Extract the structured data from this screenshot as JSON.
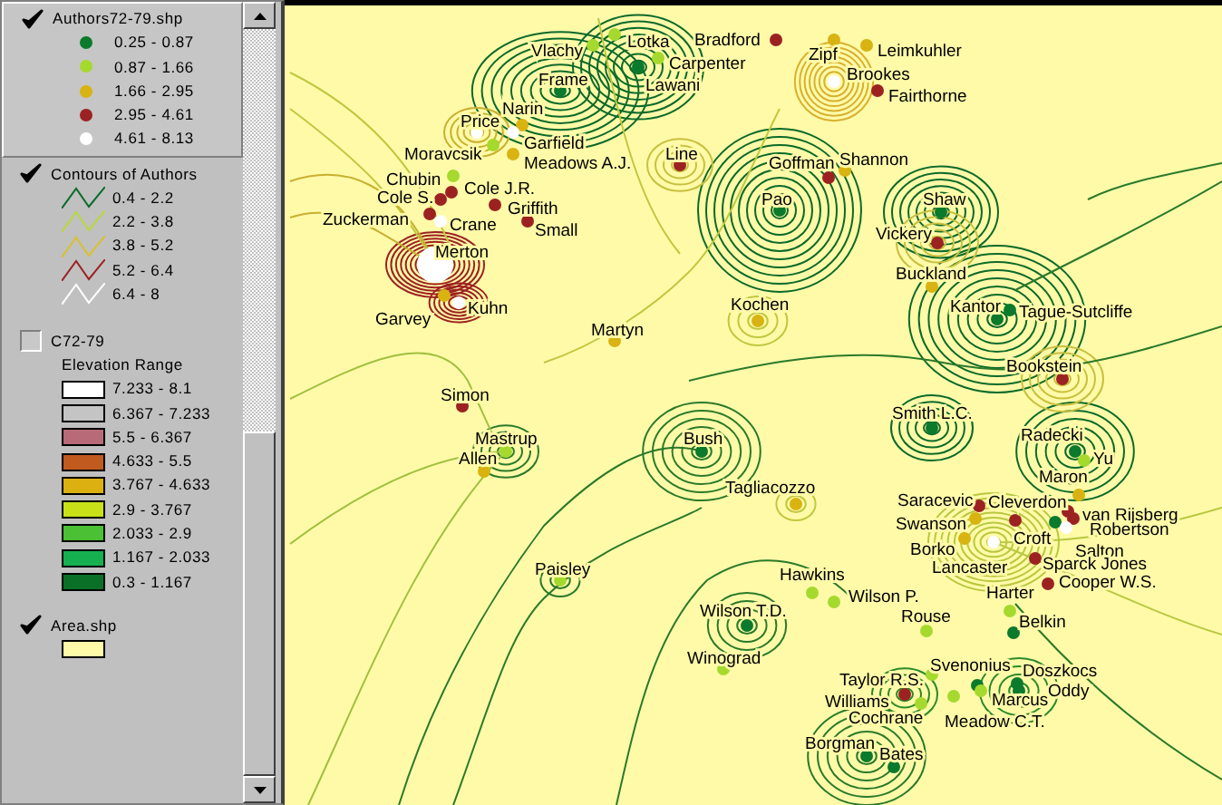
{
  "legend": {
    "layers": [
      {
        "kind": "points",
        "name": "Authors72-79.shp",
        "checked": true,
        "selected": true,
        "classes": [
          {
            "label": "0.25 - 0.87",
            "color": "#0b7a2c"
          },
          {
            "label": "0.87 - 1.66",
            "color": "#a6d92e"
          },
          {
            "label": "1.66 - 2.95",
            "color": "#d8b312"
          },
          {
            "label": "2.95 - 4.61",
            "color": "#9c2222"
          },
          {
            "label": "4.61 - 8.13",
            "color": "#ffffff"
          }
        ]
      },
      {
        "kind": "lines",
        "name": "Contours of Authors",
        "checked": true,
        "selected": false,
        "classes": [
          {
            "label": "0.4 - 2.2",
            "color": "#0b6a2a"
          },
          {
            "label": "2.2 - 3.8",
            "color": "#b8d93a"
          },
          {
            "label": "3.8 - 5.2",
            "color": "#d8c030"
          },
          {
            "label": "5.2 - 6.4",
            "color": "#9c2222"
          },
          {
            "label": "6.4 - 8",
            "color": "#ffffff"
          }
        ]
      },
      {
        "kind": "raster",
        "name": "C72-79",
        "subtitle": "Elevation Range",
        "checked": false,
        "selected": false,
        "classes": [
          {
            "label": "7.233 - 8.1",
            "color": "#ffffff"
          },
          {
            "label": "6.367 - 7.233",
            "color": "#c4c4c4"
          },
          {
            "label": "5.5 - 6.367",
            "color": "#b86a78"
          },
          {
            "label": "4.633 - 5.5",
            "color": "#c05a1e"
          },
          {
            "label": "3.767 - 4.633",
            "color": "#dcb010"
          },
          {
            "label": "2.9 - 3.767",
            "color": "#c8e018"
          },
          {
            "label": "2.033 - 2.9",
            "color": "#4cc034"
          },
          {
            "label": "1.167 - 2.033",
            "color": "#16b050"
          },
          {
            "label": "0.3 - 1.167",
            "color": "#0a7028"
          }
        ]
      },
      {
        "kind": "polygon",
        "name": "Area.shp",
        "checked": true,
        "selected": false,
        "classes": [
          {
            "color": "#fffaa8"
          }
        ]
      }
    ]
  },
  "map": {
    "authors": [
      {
        "label": "Vlachy",
        "color": "#a6d92e"
      },
      {
        "label": "Lotka",
        "color": "#a6d92e"
      },
      {
        "label": "Bradford",
        "color": "#9c2222"
      },
      {
        "label": "Carpenter",
        "color": "#a6d92e"
      },
      {
        "label": "Lawani",
        "color": "#0b7a2c"
      },
      {
        "label": "Frame",
        "color": "#0b7a2c"
      },
      {
        "label": "Narin",
        "color": "#d8b312"
      },
      {
        "label": "Price",
        "color": "#ffffff"
      },
      {
        "label": "Garfield",
        "color": "#ffffff"
      },
      {
        "label": "Moravcsik",
        "color": "#a6d92e"
      },
      {
        "label": "Meadows A.J.",
        "color": "#d8b312"
      },
      {
        "label": "Line",
        "color": "#9c2222"
      },
      {
        "label": "Chubin",
        "color": "#a6d92e"
      },
      {
        "label": "Cole J.R.",
        "color": "#9c2222"
      },
      {
        "label": "Cole S.",
        "color": "#9c2222"
      },
      {
        "label": "Griffith",
        "color": "#9c2222"
      },
      {
        "label": "Zuckerman",
        "color": "#9c2222"
      },
      {
        "label": "Crane",
        "color": "#ffffff"
      },
      {
        "label": "Small",
        "color": "#9c2222"
      },
      {
        "label": "Merton",
        "color": "#ffffff"
      },
      {
        "label": "Kuhn",
        "color": "#ffffff"
      },
      {
        "label": "Garvey",
        "color": "#d8b312"
      },
      {
        "label": "Martyn",
        "color": "#d8b312"
      },
      {
        "label": "Kochen",
        "color": "#d8b312"
      },
      {
        "label": "Simon",
        "color": "#9c2222"
      },
      {
        "label": "Mastrup",
        "color": "#a6d92e"
      },
      {
        "label": "Allen",
        "color": "#d8b312"
      },
      {
        "label": "Bush",
        "color": "#0b7a2c"
      },
      {
        "label": "Paisley",
        "color": "#a6d92e"
      },
      {
        "label": "Wilson T.D.",
        "color": "#0b7a2c"
      },
      {
        "label": "Winograd",
        "color": "#a6d92e"
      },
      {
        "label": "Zipf",
        "color": "#d8b312"
      },
      {
        "label": "Leimkuhler",
        "color": "#d8b312"
      },
      {
        "label": "Brookes",
        "color": "#ffffff"
      },
      {
        "label": "Fairthorne",
        "color": "#9c2222"
      },
      {
        "label": "Goffman",
        "color": "#9c2222"
      },
      {
        "label": "Shannon",
        "color": "#d8b312"
      },
      {
        "label": "Pao",
        "color": "#0b7a2c"
      },
      {
        "label": "Shaw",
        "color": "#0b7a2c"
      },
      {
        "label": "Vickery",
        "color": "#9c2222"
      },
      {
        "label": "Buckland",
        "color": "#d8b312"
      },
      {
        "label": "Kantor",
        "color": "#0b7a2c"
      },
      {
        "label": "Tague-Sutcliffe",
        "color": "#0b7a2c"
      },
      {
        "label": "Bookstein",
        "color": "#9c2222"
      },
      {
        "label": "Smith L.C.",
        "color": "#0b7a2c"
      },
      {
        "label": "Radecki",
        "color": "#0b7a2c"
      },
      {
        "label": "Yu",
        "color": "#a6d92e"
      },
      {
        "label": "Tagliacozzo",
        "color": "#d8b312"
      },
      {
        "label": "Maron",
        "color": "#d8b312"
      },
      {
        "label": "Saracevic",
        "color": "#9c2222"
      },
      {
        "label": "Cleverdon",
        "color": "#9c2222"
      },
      {
        "label": "van Rijsberg",
        "color": "#9c2222"
      },
      {
        "label": "Swanson",
        "color": "#d8b312"
      },
      {
        "label": "Robertson",
        "color": "#9c2222"
      },
      {
        "label": "Croft",
        "color": "#0b7a2c"
      },
      {
        "label": "Salton",
        "color": "#ffffff"
      },
      {
        "label": "Borko",
        "color": "#d8b312"
      },
      {
        "label": "Lancaster",
        "color": "#ffffff"
      },
      {
        "label": "Sparck Jones",
        "color": "#9c2222"
      },
      {
        "label": "Cooper W.S.",
        "color": "#9c2222"
      },
      {
        "label": "Hawkins",
        "color": "#a6d92e"
      },
      {
        "label": "Wilson P.",
        "color": "#a6d92e"
      },
      {
        "label": "Harter",
        "color": "#a6d92e"
      },
      {
        "label": "Rouse",
        "color": "#a6d92e"
      },
      {
        "label": "Belkin",
        "color": "#0b7a2c"
      },
      {
        "label": "Svenonius",
        "color": "#0b7a2c"
      },
      {
        "label": "Doszkocs",
        "color": "#0b7a2c"
      },
      {
        "label": "Taylor R.S.",
        "color": "#a6d92e"
      },
      {
        "label": "Oddy",
        "color": "#0b7a2c"
      },
      {
        "label": "Williams",
        "color": "#9c2222"
      },
      {
        "label": "Marcus",
        "color": "#a6d92e"
      },
      {
        "label": "Cochrane",
        "color": "#a6d92e"
      },
      {
        "label": "Meadow C.T.",
        "color": "#a6d92e"
      },
      {
        "label": "Borgman",
        "color": "#0b7a2c"
      },
      {
        "label": "Bates",
        "color": "#0b7a2c"
      }
    ]
  }
}
